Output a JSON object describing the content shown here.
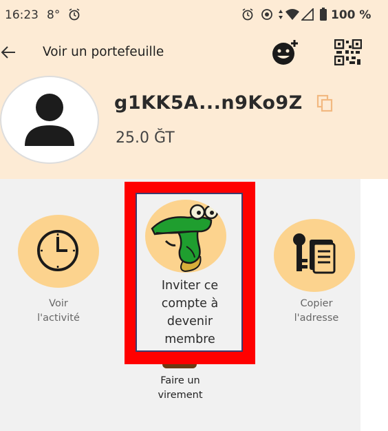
{
  "status_bar": {
    "time": "16:23",
    "temp": "8°",
    "battery": "100 %"
  },
  "app_bar": {
    "title": "Voir un portefeuille"
  },
  "wallet": {
    "address": "g1KK5A...n9Ko9Z",
    "balance": "25.0 ĞT"
  },
  "actions": {
    "activity": {
      "line1": "Voir",
      "line2": "l'activité"
    },
    "invite": {
      "line1": "Inviter ce",
      "line2": "compte à",
      "line3": "devenir",
      "line4": "membre"
    },
    "copy": {
      "line1": "Copier",
      "line2": "l'adresse"
    },
    "transfer": {
      "line1": "Faire un",
      "line2": "virement"
    }
  },
  "colors": {
    "header_bg": "#fdebd5",
    "action_bg": "#fcd38e",
    "highlight": "#ff0000"
  }
}
